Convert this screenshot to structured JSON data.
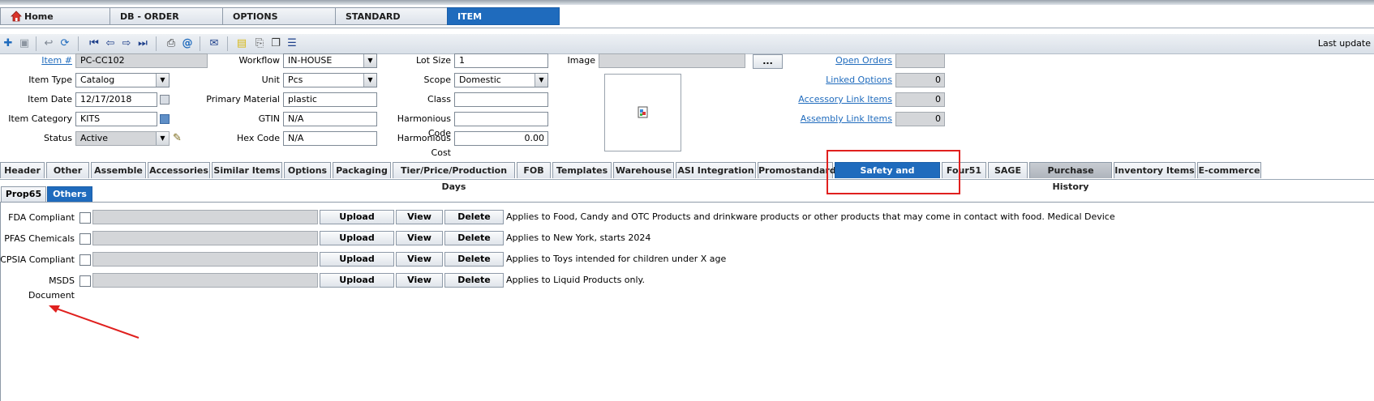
{
  "nav": {
    "tabs": [
      "Home",
      "DB - ORDER",
      "OPTIONS",
      "STANDARD",
      "ITEM"
    ],
    "active": "ITEM"
  },
  "toolbar": {
    "last_update": "Last update"
  },
  "form": {
    "item_no_label": "Item #",
    "item_no": "PC-CC102",
    "item_type_label": "Item Type",
    "item_type": "Catalog",
    "item_date_label": "Item Date",
    "item_date": "12/17/2018",
    "item_category_label": "Item Category",
    "item_category": "KITS",
    "status_label": "Status",
    "status": "Active",
    "workflow_label": "Workflow",
    "workflow": "IN-HOUSE",
    "unit_label": "Unit",
    "unit": "Pcs",
    "primary_material_label": "Primary Material",
    "primary_material": "plastic",
    "gtin_label": "GTIN",
    "gtin": "N/A",
    "hex_code_label": "Hex Code",
    "hex_code": "N/A",
    "lot_size_label": "Lot Size",
    "lot_size": "1",
    "scope_label": "Scope",
    "scope": "Domestic",
    "class_label": "Class",
    "class": "",
    "harmonious_code_label": "Harmonious Code",
    "harmonious_code": "",
    "harmonious_cost_label": "Harmonious Cost",
    "harmonious_cost": "0.00",
    "image_label": "Image",
    "image_browse": "...",
    "open_orders_label": "Open Orders",
    "open_orders": "",
    "linked_options_label": "Linked Options",
    "linked_options": "0",
    "accessory_link_label": "Accessory Link Items",
    "accessory_link": "0",
    "assembly_link_label": "Assembly Link Items",
    "assembly_link": "0"
  },
  "section_tabs": [
    "Header",
    "Other",
    "Assemble",
    "Accessories",
    "Similar Items",
    "Options",
    "Packaging",
    "Tier/Price/Production Days",
    "FOB",
    "Templates",
    "Warehouse",
    "ASI Integration",
    "Promostandard",
    "Safety and Compliance",
    "Four51",
    "SAGE",
    "Purchase History",
    "Inventory Items",
    "E-commerce"
  ],
  "active_section_tab": "Safety and Compliance",
  "sub_tabs": [
    "Prop65",
    "Others"
  ],
  "active_sub_tab": "Others",
  "docs": {
    "upload": "Upload",
    "view": "View",
    "delete": "Delete",
    "rows": [
      {
        "label": "FDA Compliant",
        "desc": "Applies to Food, Candy and OTC Products and drinkware products or other products that may come in contact with food. Medical Device"
      },
      {
        "label": "PFAS Chemicals",
        "desc": "Applies to New York, starts 2024"
      },
      {
        "label": "CPSIA Compliant",
        "desc": "Applies to Toys intended for children under X age"
      },
      {
        "label": "MSDS Document",
        "desc": "Applies to Liquid Products only."
      }
    ]
  },
  "annotation_color": "#e0201e",
  "accent_color": "#1f6bbd"
}
